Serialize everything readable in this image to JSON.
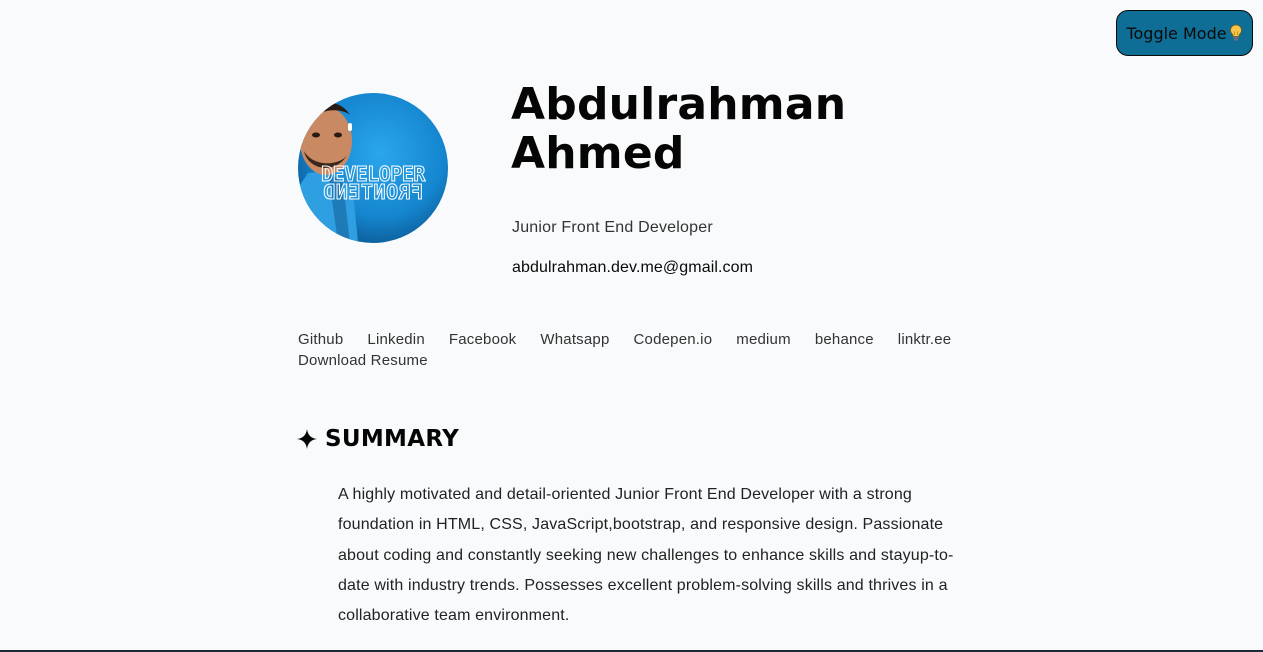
{
  "toggle": {
    "label": "Toggle Mode",
    "icon": "lightbulb-icon"
  },
  "profile": {
    "first_name": "Abdulrahman",
    "last_name": "Ahmed",
    "role": "Junior Front End Developer",
    "email": "abdulrahman.dev.me@gmail.com",
    "avatar_text_top": "DEVELOPER",
    "avatar_text_bottom": "FRONTEND"
  },
  "links": [
    {
      "label": "Github"
    },
    {
      "label": "Linkedin"
    },
    {
      "label": "Facebook"
    },
    {
      "label": "Whatsapp"
    },
    {
      "label": "Codepen.io"
    },
    {
      "label": "medium"
    },
    {
      "label": "behance"
    },
    {
      "label": "linktr.ee"
    },
    {
      "label": "Download Resume"
    }
  ],
  "summary": {
    "title": "SUMMARY",
    "icon": "sparkle-icon",
    "text": "A highly motivated and detail-oriented Junior Front End Developer with a strong foundation in HTML, CSS, JavaScript,bootstrap, and responsive design. Passionate about coding and constantly seeking new challenges to enhance skills and stayup-to-date with industry trends. Possesses excellent problem-solving skills and thrives in a collaborative team environment."
  },
  "colors": {
    "background": "#f8fafc",
    "toggle_button": "#0f6e96",
    "avatar_blue": "#1586cf",
    "text": "#050505"
  }
}
